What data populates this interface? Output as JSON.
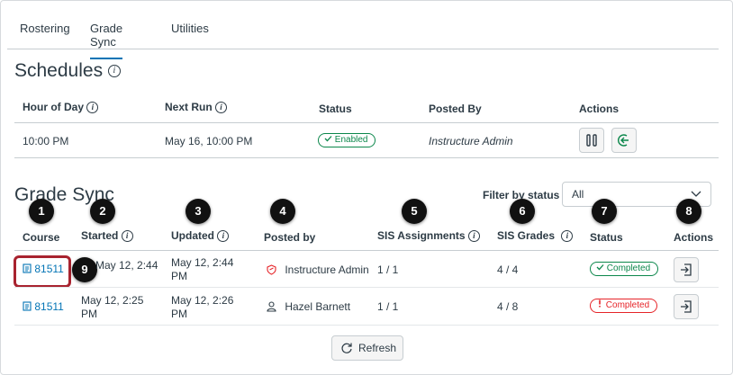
{
  "tabs": [
    {
      "label": "Rostering"
    },
    {
      "label": "Grade Sync"
    },
    {
      "label": "Utilities"
    }
  ],
  "schedules": {
    "heading": "Schedules",
    "headers": {
      "hour": "Hour of Day",
      "next_run": "Next Run",
      "status": "Status",
      "posted_by": "Posted By",
      "actions": "Actions"
    },
    "row": {
      "hour": "10:00 PM",
      "next_run": "May 16, 10:00 PM",
      "status": "Enabled",
      "posted_by": "Instructure Admin"
    }
  },
  "grade_sync": {
    "heading": "Grade Sync",
    "filter_label": "Filter by status",
    "filter_value": "All",
    "headers": {
      "course": "Course",
      "started": "Started",
      "updated": "Updated",
      "posted_by": "Posted by",
      "sis_assignments": "SIS Assignments",
      "sis_grades": "SIS Grades",
      "status": "Status",
      "actions": "Actions"
    },
    "rows": [
      {
        "course": "81511",
        "started": "May 12, 2:44",
        "started_2": "",
        "updated": "May 12, 2:44",
        "updated_2": "PM",
        "posted_by": "Instructure Admin",
        "sis_assignments": "1 / 1",
        "sis_grades": "4 / 4",
        "status": "Completed"
      },
      {
        "course": "81511",
        "started": "May 12, 2:25",
        "started_2": "PM",
        "updated": "May 12, 2:26",
        "updated_2": "PM",
        "posted_by": "Hazel Barnett",
        "sis_assignments": "1 / 1",
        "sis_grades": "4 / 8",
        "status": "Completed"
      }
    ],
    "refresh_label": "Refresh"
  },
  "badges": [
    "1",
    "2",
    "3",
    "4",
    "5",
    "6",
    "7",
    "8",
    "9"
  ],
  "info_glyph": "i",
  "colors": {
    "accent": "#0374b5",
    "success": "#0b874b",
    "error": "#e62429",
    "callout": "#a8232f"
  }
}
